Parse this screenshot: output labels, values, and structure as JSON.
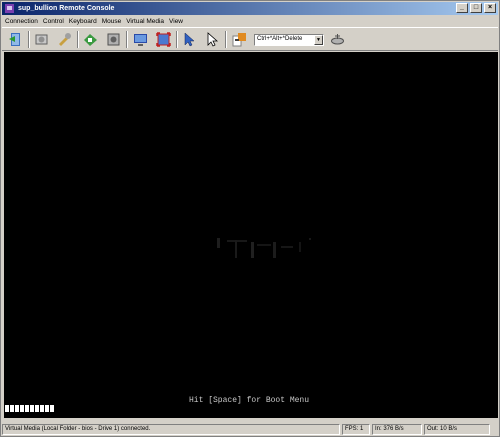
{
  "window": {
    "title": "sup_bullion Remote Console",
    "icon": "console-app-icon",
    "buttons": {
      "minimize": "_",
      "maximize": "□",
      "close": "×"
    }
  },
  "menu": [
    "Connection",
    "Control",
    "Keyboard",
    "Mouse",
    "Virtual Media",
    "View"
  ],
  "toolbar": {
    "icons": [
      "exit-icon",
      "settings-icon",
      "tools-icon",
      "connect-icon",
      "record-icon",
      "refresh-screen-icon",
      "fullscreen-icon",
      "cursor-icon",
      "pointer-icon",
      "send-keys-icon",
      "macro-icon"
    ],
    "key_combo": {
      "selected": "Ctrl+*Alt+*Delete",
      "arrow": "▼"
    }
  },
  "screen": {
    "boot_message": "Hit [Space] for Boot Menu",
    "progress_blocks": 10
  },
  "status": {
    "message": "Virtual Media (Local Folder - bios - Drive 1) connected.",
    "fps": "FPS: 1",
    "in_rate": "In: 376 B/s",
    "out_rate": "Out: 10 B/s"
  }
}
